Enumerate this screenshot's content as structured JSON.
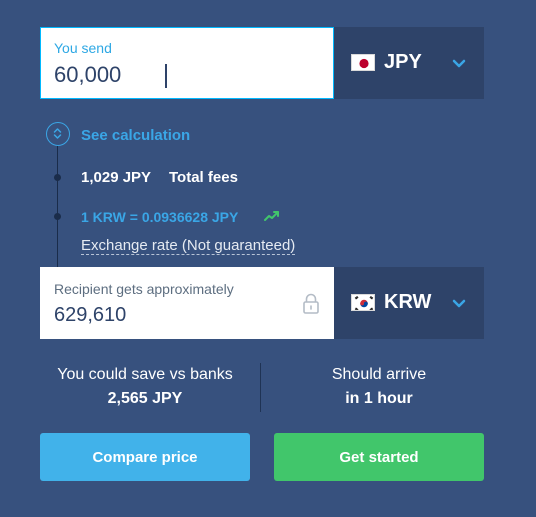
{
  "send": {
    "label": "You send",
    "amount": "60,000",
    "currency": "JPY",
    "flag": "japan-flag"
  },
  "calculation": {
    "toggle_label": "See calculation",
    "fee_amount": "1,029 JPY",
    "fee_label": "Total fees",
    "rate": "1 KRW = 0.0936628 JPY",
    "rate_trend_icon": "trend-up-icon",
    "rate_note": "Exchange rate (Not guaranteed)"
  },
  "receive": {
    "label": "Recipient gets approximately",
    "amount": "629,610",
    "currency": "KRW",
    "flag": "south-korea-flag",
    "lock_icon": "lock-icon"
  },
  "savings": {
    "label": "You could save vs banks",
    "value": "2,565 JPY"
  },
  "arrival": {
    "label": "Should arrive",
    "value": "in 1 hour"
  },
  "buttons": {
    "compare": "Compare price",
    "start": "Get started"
  },
  "colors": {
    "background": "#37517e",
    "panel_dark": "#2e4369",
    "accent_blue": "#3aa6e6",
    "compare_button": "#41b2ea",
    "start_button": "#41c66b",
    "trend_green": "#41c66b"
  }
}
